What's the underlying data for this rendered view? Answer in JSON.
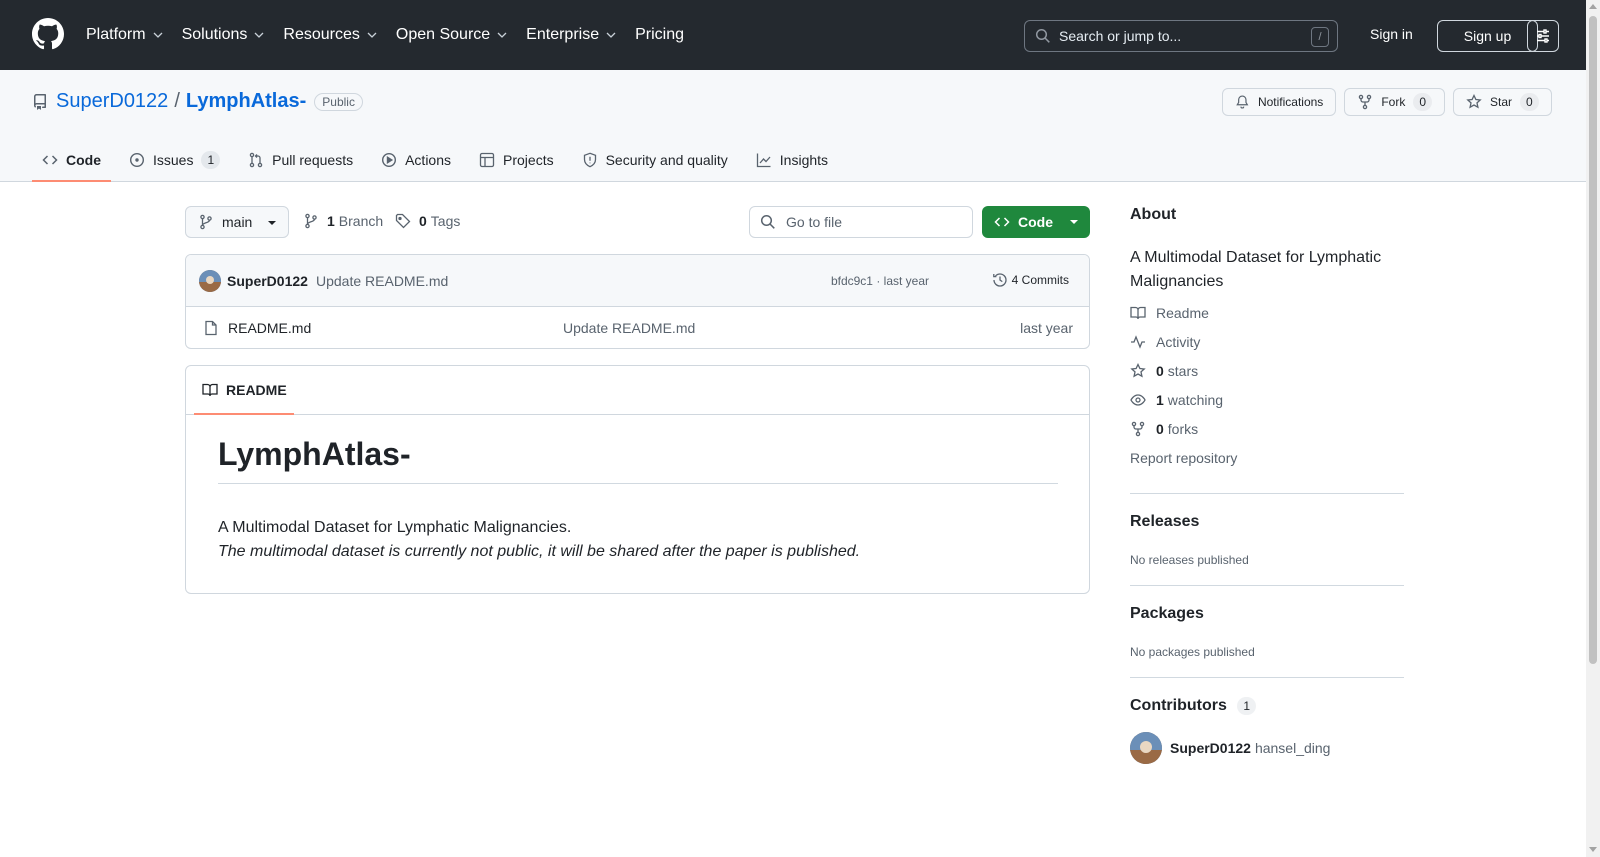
{
  "header": {
    "nav": [
      {
        "label": "Platform",
        "has_menu": true
      },
      {
        "label": "Solutions",
        "has_menu": true
      },
      {
        "label": "Resources",
        "has_menu": true
      },
      {
        "label": "Open Source",
        "has_menu": true
      },
      {
        "label": "Enterprise",
        "has_menu": true
      },
      {
        "label": "Pricing",
        "has_menu": false
      }
    ],
    "search_placeholder": "Search or jump to...",
    "search_shortcut": "/",
    "sign_in": "Sign in",
    "sign_up": "Sign up"
  },
  "repo": {
    "owner": "SuperD0122",
    "separator": "/",
    "name": "LymphAtlas-",
    "visibility": "Public",
    "notifications_label": "Notifications",
    "fork_label": "Fork",
    "fork_count": "0",
    "star_label": "Star",
    "star_count": "0"
  },
  "tabs": [
    {
      "label": "Code",
      "icon": "code-icon",
      "active": true,
      "count": ""
    },
    {
      "label": "Issues",
      "icon": "issue-icon",
      "active": false,
      "count": "1"
    },
    {
      "label": "Pull requests",
      "icon": "pull-request-icon",
      "active": false,
      "count": ""
    },
    {
      "label": "Actions",
      "icon": "play-icon",
      "active": false,
      "count": ""
    },
    {
      "label": "Projects",
      "icon": "table-icon",
      "active": false,
      "count": ""
    },
    {
      "label": "Security and quality",
      "icon": "shield-icon",
      "active": false,
      "count": ""
    },
    {
      "label": "Insights",
      "icon": "graph-icon",
      "active": false,
      "count": ""
    }
  ],
  "toolbar": {
    "branch": "main",
    "branch_count": "1",
    "branch_label": "Branch",
    "tag_count": "0",
    "tag_label": "Tags",
    "goto_placeholder": "Go to file",
    "code_button": "Code"
  },
  "latest_commit": {
    "author": "SuperD0122",
    "message": "Update README.md",
    "meta": "bfdc9c1 · last year",
    "commits_label": "4 Commits"
  },
  "files": [
    {
      "name": "README.md",
      "message": "Update README.md",
      "time": "last year"
    }
  ],
  "readme": {
    "tab_label": "README",
    "heading": "LymphAtlas-",
    "line1": "A Multimodal Dataset for Lymphatic Malignancies.",
    "line2": "The multimodal dataset is currently not public, it will be shared after the paper is published."
  },
  "sidebar": {
    "about_title": "About",
    "about_description": "A Multimodal Dataset for Lymphatic Malignancies",
    "readme_link": "Readme",
    "activity_link": "Activity",
    "stars_count": "0",
    "stars_label": "stars",
    "watching_count": "1",
    "watching_label": "watching",
    "forks_count": "0",
    "forks_label": "forks",
    "report_link": "Report repository",
    "releases_title": "Releases",
    "releases_text": "No releases published",
    "packages_title": "Packages",
    "packages_text": "No packages published",
    "contributors_title": "Contributors",
    "contributors_count": "1",
    "contributor_name": "SuperD0122",
    "contributor_login": "hansel_ding"
  },
  "colors": {
    "header_bg": "#24292f",
    "link": "#0969da",
    "primary_button": "#1f883d",
    "active_tab_underline": "#fd8c73"
  }
}
